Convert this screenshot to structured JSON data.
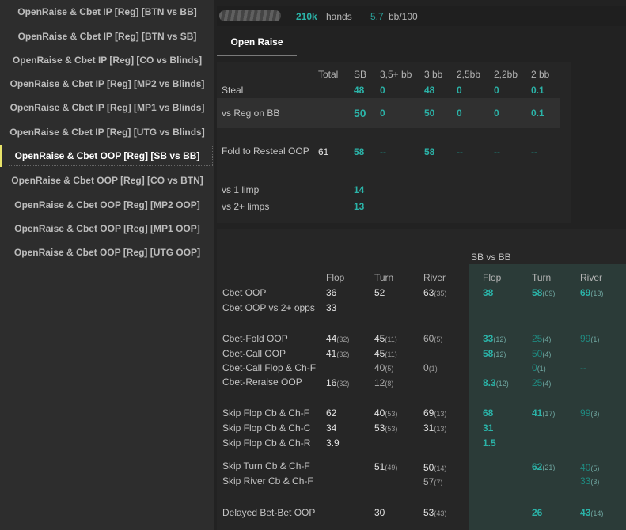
{
  "sidebar": {
    "items": [
      "OpenRaise & Cbet IP [Reg] [BTN vs BB]",
      "OpenRaise & Cbet IP [Reg] [BTN vs SB]",
      "OpenRaise & Cbet IP [Reg] [CO vs Blinds]",
      "OpenRaise & Cbet IP [Reg] [MP2 vs Blinds]",
      "OpenRaise & Cbet IP [Reg] [MP1 vs Blinds]",
      "OpenRaise & Cbet IP [Reg] [UTG vs Blinds]",
      "OpenRaise & Cbet OOP [Reg] [SB vs BB]",
      "OpenRaise & Cbet OOP [Reg] [CO vs BTN]",
      "OpenRaise & Cbet OOP [Reg] [MP2 OOP]",
      "OpenRaise & Cbet OOP [Reg] [MP1 OOP]",
      "OpenRaise & Cbet OOP [Reg] [UTG OOP]"
    ],
    "active_index": 6
  },
  "header": {
    "hands_value": "210k",
    "hands_label": "hands",
    "bb_value": "5.7",
    "bb_label": "bb/100"
  },
  "tab": {
    "label": "Open Raise"
  },
  "open_raise": {
    "columns": [
      "Total",
      "SB",
      "3,5+ bb",
      "3 bb",
      "2,5bb",
      "2,2bb",
      "2 bb"
    ],
    "steal": {
      "label": "Steal",
      "sb": "48",
      "c35": "0",
      "c3": "48",
      "c25": "0",
      "c22": "0",
      "c2": "0.1"
    },
    "vs_reg_bb": {
      "label": "vs Reg on BB",
      "sb": "50",
      "c35": "0",
      "c3": "50",
      "c25": "0",
      "c22": "0",
      "c2": "0.1"
    },
    "fold_resteal": {
      "label": "Fold to Resteal OOP",
      "total": "61",
      "sb": "58",
      "c35": "--",
      "c3": "58",
      "c25": "--",
      "c22": "--",
      "c2": "--"
    },
    "vs_1_limp": {
      "label": "vs 1 limp",
      "sb": "14"
    },
    "vs_2_limps": {
      "label": "vs 2+ limps",
      "sb": "13"
    }
  },
  "cbet": {
    "group_header": "SB vs BB",
    "col_flop": "Flop",
    "col_turn": "Turn",
    "col_river": "River",
    "rows": {
      "cbet_oop": {
        "label": "Cbet OOP",
        "flop": "36",
        "turn": "52",
        "river": "63",
        "river_sub": "(35)",
        "sb_flop": "38",
        "sb_turn": "58",
        "sb_turn_sub": "(69)",
        "sb_river": "69",
        "sb_river_sub": "(13)"
      },
      "cbet_oop_2": {
        "label": "Cbet OOP vs 2+ opps",
        "flop": "33"
      },
      "cbet_fold": {
        "label": "Cbet-Fold OOP",
        "flop": "44",
        "flop_sub": "(32)",
        "turn": "45",
        "turn_sub": "(11)",
        "river": "60",
        "river_sub": "(5)",
        "sb_flop": "33",
        "sb_flop_sub": "(12)",
        "sb_turn": "25",
        "sb_turn_sub": "(4)",
        "sb_river": "99",
        "sb_river_sub": "(1)"
      },
      "cbet_call": {
        "label": "Cbet-Call OOP",
        "flop": "41",
        "flop_sub": "(32)",
        "turn": "45",
        "turn_sub": "(11)",
        "sb_flop": "58",
        "sb_flop_sub": "(12)",
        "sb_turn": "50",
        "sb_turn_sub": "(4)"
      },
      "cbet_call_chf": {
        "label": "Cbet-Call Flop & Ch-F",
        "turn": "40",
        "turn_sub": "(5)",
        "river": "0",
        "river_sub": "(1)",
        "sb_turn": "0",
        "sb_turn_sub": "(1)",
        "sb_river": "--"
      },
      "cbet_reraise": {
        "label": "Cbet-Reraise OOP",
        "flop": "16",
        "flop_sub": "(32)",
        "turn": "12",
        "turn_sub": "(8)",
        "sb_flop": "8.3",
        "sb_flop_sub": "(12)",
        "sb_turn": "25",
        "sb_turn_sub": "(4)"
      },
      "skip_flop_chf": {
        "label": "Skip Flop Cb & Ch-F",
        "flop": "62",
        "turn": "40",
        "turn_sub": "(53)",
        "river": "69",
        "river_sub": "(13)",
        "sb_flop": "68",
        "sb_turn": "41",
        "sb_turn_sub": "(17)",
        "sb_river": "99",
        "sb_river_sub": "(3)"
      },
      "skip_flop_chc": {
        "label": "Skip Flop Cb & Ch-C",
        "flop": "34",
        "turn": "53",
        "turn_sub": "(53)",
        "river": "31",
        "river_sub": "(13)",
        "sb_flop": "31"
      },
      "skip_flop_chr": {
        "label": "Skip Flop Cb & Ch-R",
        "flop": "3.9",
        "sb_flop": "1.5"
      },
      "skip_turn_chf": {
        "label": "Skip Turn Cb & Ch-F",
        "turn": "51",
        "turn_sub": "(49)",
        "river": "50",
        "river_sub": "(14)",
        "sb_turn": "62",
        "sb_turn_sub": "(21)",
        "sb_river": "40",
        "sb_river_sub": "(5)"
      },
      "skip_river_chf": {
        "label": "Skip River Cb & Ch-F",
        "river": "57",
        "river_sub": "(7)",
        "sb_river": "33",
        "sb_river_sub": "(3)"
      },
      "delayed": {
        "label": "Delayed Bet-Bet OOP",
        "turn": "30",
        "river": "53",
        "river_sub": "(43)",
        "sb_turn": "26",
        "sb_river": "43",
        "sb_river_sub": "(14)"
      }
    }
  }
}
